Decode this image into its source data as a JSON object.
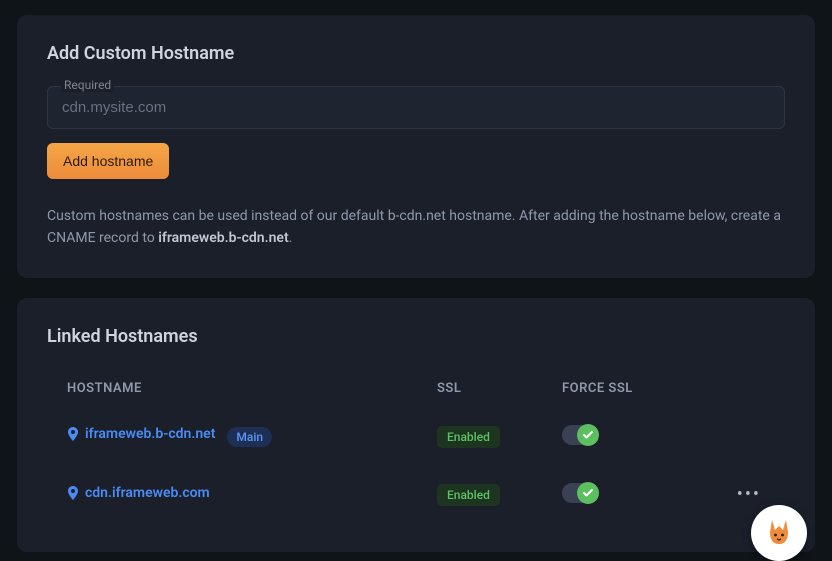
{
  "add_panel": {
    "title": "Add Custom Hostname",
    "input_label": "Required",
    "input_placeholder": "cdn.mysite.com",
    "input_value": "",
    "button_label": "Add hostname",
    "help_prefix": "Custom hostnames can be used instead of our default b-cdn.net hostname. After adding the hostname below, create a CNAME record to ",
    "help_bold": "iframeweb.b-cdn.net",
    "help_suffix": "."
  },
  "linked_panel": {
    "title": "Linked Hostnames",
    "columns": {
      "hostname": "HOSTNAME",
      "ssl": "SSL",
      "force_ssl": "FORCE SSL"
    },
    "rows": [
      {
        "hostname": "iframeweb.b-cdn.net",
        "main_badge": "Main",
        "is_main": true,
        "ssl": "Enabled",
        "force_ssl_on": true,
        "has_actions": false
      },
      {
        "hostname": "cdn.iframeweb.com",
        "main_badge": "",
        "is_main": false,
        "ssl": "Enabled",
        "force_ssl_on": true,
        "has_actions": true
      }
    ]
  },
  "icons": {
    "map_pin": "map-pin",
    "check": "✓",
    "more": "•••"
  }
}
